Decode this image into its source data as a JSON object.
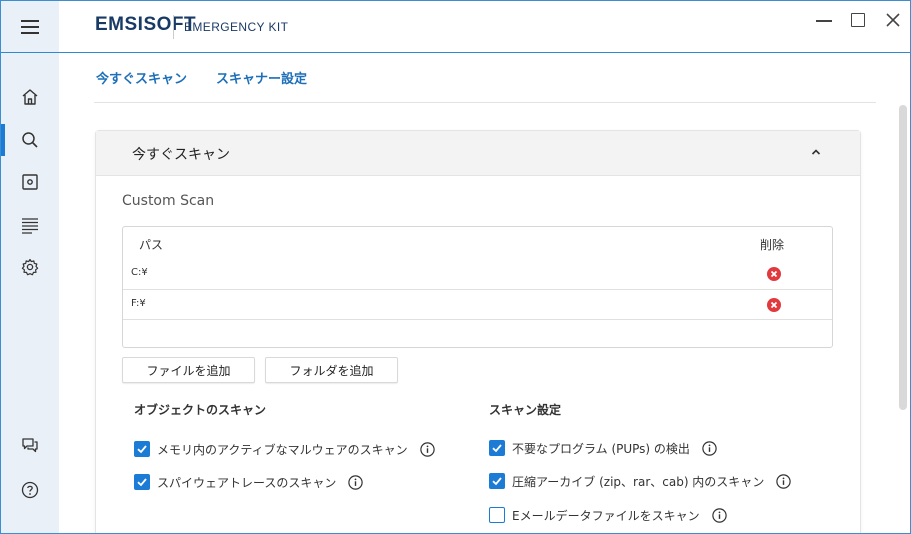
{
  "app": {
    "logo_text": "EMSISOFT",
    "product_name": "EMERGENCY KIT"
  },
  "sidebar": {
    "items": [
      {
        "icon": "home-icon",
        "active": false
      },
      {
        "icon": "search-icon",
        "active": true
      },
      {
        "icon": "quarantine-icon",
        "active": false
      },
      {
        "icon": "logs-icon",
        "active": false
      },
      {
        "icon": "gear-icon",
        "active": false
      },
      {
        "icon": "feedback-icon",
        "active": false
      },
      {
        "icon": "help-icon",
        "active": false
      }
    ]
  },
  "tabs": {
    "scan_now": "今すぐスキャン",
    "scanner_settings": "スキャナー設定"
  },
  "panel": {
    "title": "今すぐスキャン",
    "scan_name": "Custom Scan",
    "table": {
      "col_path": "パス",
      "col_delete": "削除",
      "rows": [
        {
          "path": "C:¥"
        },
        {
          "path": "F:¥"
        }
      ]
    },
    "buttons": {
      "add_file": "ファイルを追加",
      "add_folder": "フォルダを追加"
    },
    "objects_section": {
      "title": "オブジェクトのスキャン",
      "options": [
        {
          "label": "メモリ内のアクティブなマルウェアのスキャン",
          "checked": true
        },
        {
          "label": "スパイウェアトレースのスキャン",
          "checked": true
        }
      ]
    },
    "settings_section": {
      "title": "スキャン設定",
      "options": [
        {
          "label": "不要なプログラム (PUPs) の検出",
          "checked": true
        },
        {
          "label": "圧縮アーカイブ (zip、rar、cab) 内のスキャン",
          "checked": true
        },
        {
          "label": "Eメールデータファイルをスキャン",
          "checked": false
        }
      ]
    }
  },
  "colors": {
    "accent": "#1c7cd5",
    "sidebar_bg": "#eaf0f7",
    "delete_red": "#e0393e",
    "brand_navy": "#1a3a66"
  }
}
